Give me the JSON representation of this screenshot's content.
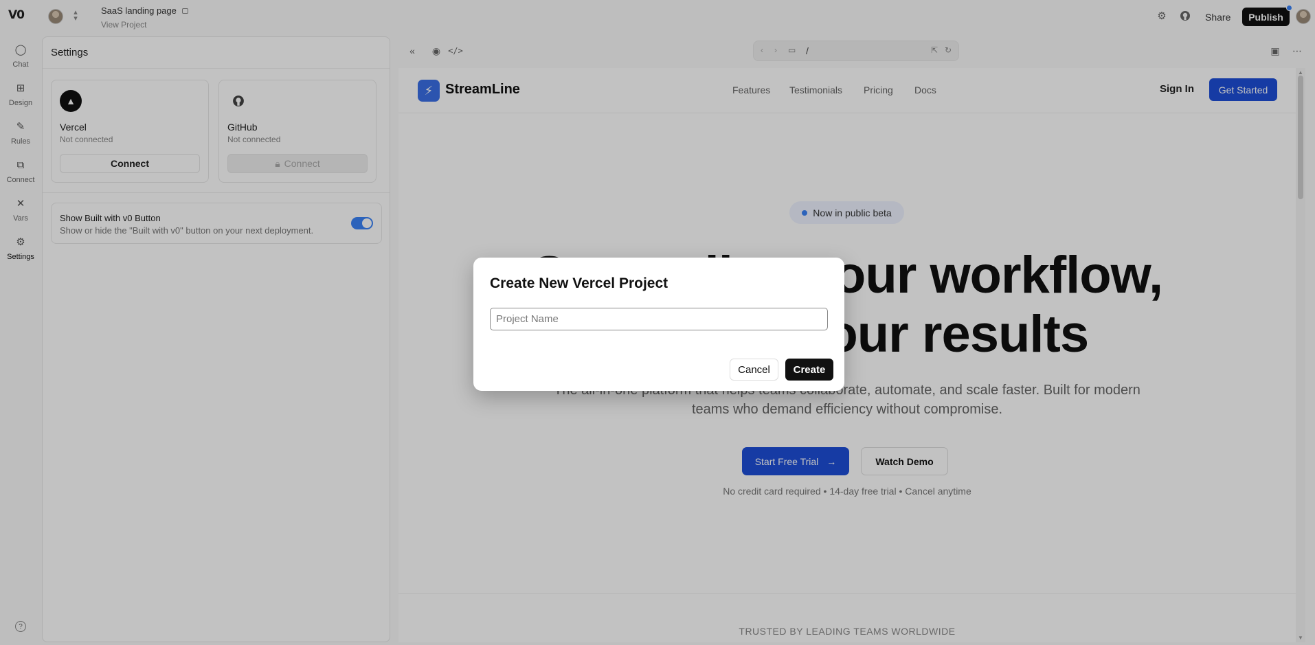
{
  "topbar": {
    "logo": "V0",
    "project_title": "SaaS landing page",
    "project_sub": "View Project",
    "share_label": "Share",
    "publish_label": "Publish",
    "icons": [
      "gear-icon",
      "github-icon"
    ]
  },
  "rail": {
    "items": [
      {
        "label": "Chat",
        "icon": "chat-icon"
      },
      {
        "label": "Design",
        "icon": "design-icon"
      },
      {
        "label": "Rules",
        "icon": "rules-icon"
      },
      {
        "label": "Connect",
        "icon": "connect-icon"
      },
      {
        "label": "Vars",
        "icon": "vars-icon"
      },
      {
        "label": "Settings",
        "icon": "gear-icon"
      }
    ],
    "help": "?"
  },
  "settings": {
    "title": "Settings",
    "vercel": {
      "name": "Vercel",
      "status": "Not connected",
      "button": "Connect"
    },
    "github": {
      "name": "GitHub",
      "status": "Not connected",
      "button": "Connect"
    },
    "built_with": {
      "title": "Show Built with v0 Button",
      "description": "Show or hide the \"Built with v0\" button on your next deployment.",
      "enabled": true
    }
  },
  "preview_bar": {
    "url_path": "/"
  },
  "site": {
    "brand": "StreamLine",
    "nav_links": [
      "Features",
      "Testimonials",
      "Pricing",
      "Docs"
    ],
    "sign_in": "Sign In",
    "get_started": "Get Started",
    "beta_pill": "Now in public beta",
    "hero_line1": "Streamline your workflow,",
    "hero_line2": "amplify your results",
    "hero_sub1": "The all-in-one platform that helps teams collaborate, automate, and scale faster. Built for modern",
    "hero_sub2": "teams who demand efficiency without compromise.",
    "cta_primary": "Start Free Trial",
    "cta_secondary": "Watch Demo",
    "note": "No credit card required • 14-day free trial • Cancel anytime",
    "trusted": "TRUSTED BY LEADING TEAMS WORLDWIDE",
    "accent": "#1d4ed8"
  },
  "modal": {
    "title": "Create New Vercel Project",
    "input_placeholder": "Project Name",
    "input_value": "",
    "cancel_label": "Cancel",
    "create_label": "Create"
  }
}
